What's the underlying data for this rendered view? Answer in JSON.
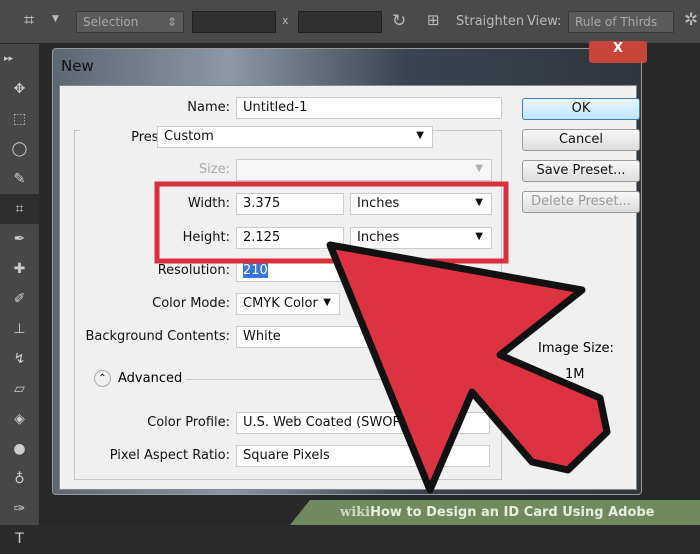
{
  "options_bar": {
    "selection": "Selection",
    "times": "x",
    "straighten": "Straighten",
    "view_label": "View:",
    "view_value": "Rule of Thirds"
  },
  "dialog": {
    "title": "New",
    "close": "X",
    "name_label": "Name:",
    "name_value": "Untitled-1",
    "preset_label": "Preset:",
    "preset_value": "Custom",
    "size_label": "Size:",
    "size_value": "",
    "width_label": "Width:",
    "width_value": "3.375",
    "width_unit": "Inches",
    "height_label": "Height:",
    "height_value": "2.125",
    "height_unit": "Inches",
    "resolution_label": "Resolution:",
    "resolution_value": "210",
    "color_mode_label": "Color Mode:",
    "color_mode_value": "CMYK Color",
    "bg_label": "Background Contents:",
    "bg_value": "White",
    "advanced": "Advanced",
    "profile_label": "Color Profile:",
    "profile_value": "U.S. Web Coated (SWOP) v2",
    "par_label": "Pixel Aspect Ratio:",
    "par_value": "Square Pixels",
    "image_size_label": "Image Size:",
    "image_size_value": "1M",
    "ok": "OK",
    "cancel": "Cancel",
    "save_preset": "Save Preset...",
    "delete_preset": "Delete Preset..."
  },
  "annotation": {
    "highlight_color": "#d9303d",
    "arrow_color": "#dc3241"
  },
  "watermark": {
    "wiki": "wiki",
    "text": "How to Design an ID Card Using Adobe Photoshop"
  }
}
